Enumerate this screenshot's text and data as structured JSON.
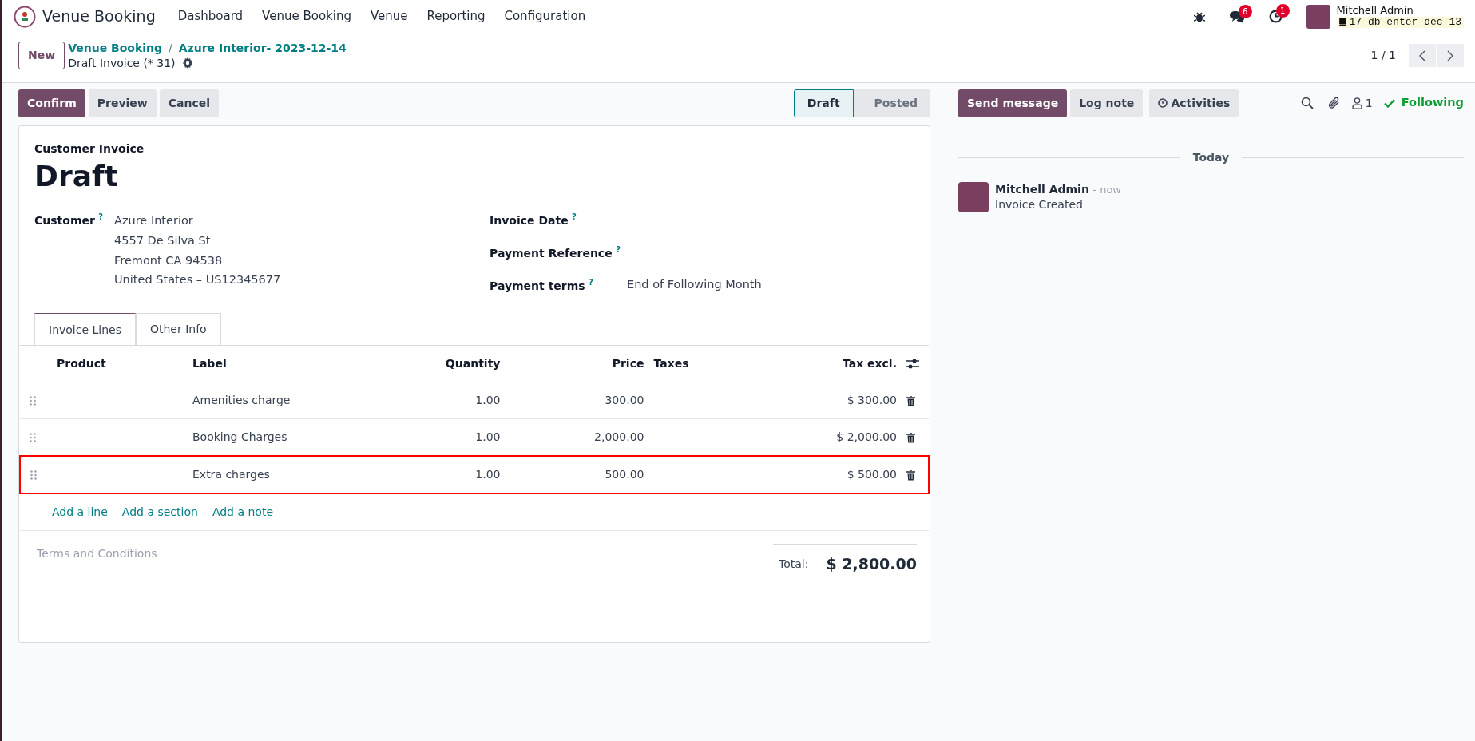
{
  "navbar": {
    "app_name": "Venue Booking",
    "menus": [
      "Dashboard",
      "Venue Booking",
      "Venue",
      "Reporting",
      "Configuration"
    ],
    "messages_badge": "6",
    "activities_badge": "1",
    "user_name": "Mitchell Admin",
    "database": "17_db_enter_dec_13"
  },
  "control_panel": {
    "new_button": "New",
    "breadcrumbs": [
      "Venue Booking",
      "Azure Interior- 2023-12-14"
    ],
    "breadcrumb_separator": "/",
    "record_title": "Draft Invoice (* 31)",
    "pager": "1 / 1"
  },
  "actions": [
    {
      "label": "Confirm",
      "kind": "primary"
    },
    {
      "label": "Preview",
      "kind": "secondary"
    },
    {
      "label": "Cancel",
      "kind": "secondary"
    }
  ],
  "statusbar": [
    {
      "label": "Draft",
      "selected": true
    },
    {
      "label": "Posted",
      "selected": false
    }
  ],
  "form": {
    "subtitle": "Customer Invoice",
    "title": "Draft",
    "customer": {
      "label": "Customer",
      "help": "?",
      "lines": [
        "Azure Interior",
        "4557 De Silva St",
        "Fremont CA 94538",
        "United States – US12345677"
      ]
    },
    "right_fields": [
      {
        "label": "Invoice Date",
        "help": "?"
      },
      {
        "label": "Payment Reference",
        "help": "?"
      },
      {
        "label": "Payment terms",
        "help": "?",
        "value": "End of Following Month"
      }
    ],
    "tabs": [
      {
        "label": "Invoice Lines",
        "selected": true
      },
      {
        "label": "Other Info",
        "selected": false
      }
    ],
    "table": {
      "columns": [
        "Product",
        "Label",
        "Quantity",
        "Price",
        "Taxes",
        "Tax excl."
      ],
      "rows": [
        {
          "label": "Amenities charge",
          "quantity": "1.00",
          "price": "300.00",
          "tax_excl": "$ 300.00",
          "highlighted": false
        },
        {
          "label": "Booking Charges",
          "quantity": "1.00",
          "price": "2,000.00",
          "tax_excl": "$ 2,000.00",
          "highlighted": false
        },
        {
          "label": "Extra charges",
          "quantity": "1.00",
          "price": "500.00",
          "tax_excl": "$ 500.00",
          "highlighted": true
        }
      ],
      "add_links": [
        "Add a line",
        "Add a section",
        "Add a note"
      ]
    },
    "terms_placeholder": "Terms and Conditions",
    "total_label": "Total:",
    "total_value": "$ 2,800.00"
  },
  "chatter": {
    "buttons": [
      {
        "label": "Send message",
        "kind": "primary"
      },
      {
        "label": "Log note",
        "kind": "secondary"
      },
      {
        "label": "Activities",
        "kind": "activities"
      }
    ],
    "followers_count": "1",
    "follow_label": "Following",
    "date_separator": "Today",
    "messages": [
      {
        "author": "Mitchell Admin",
        "time": "- now",
        "body": "Invoice Created"
      }
    ]
  }
}
